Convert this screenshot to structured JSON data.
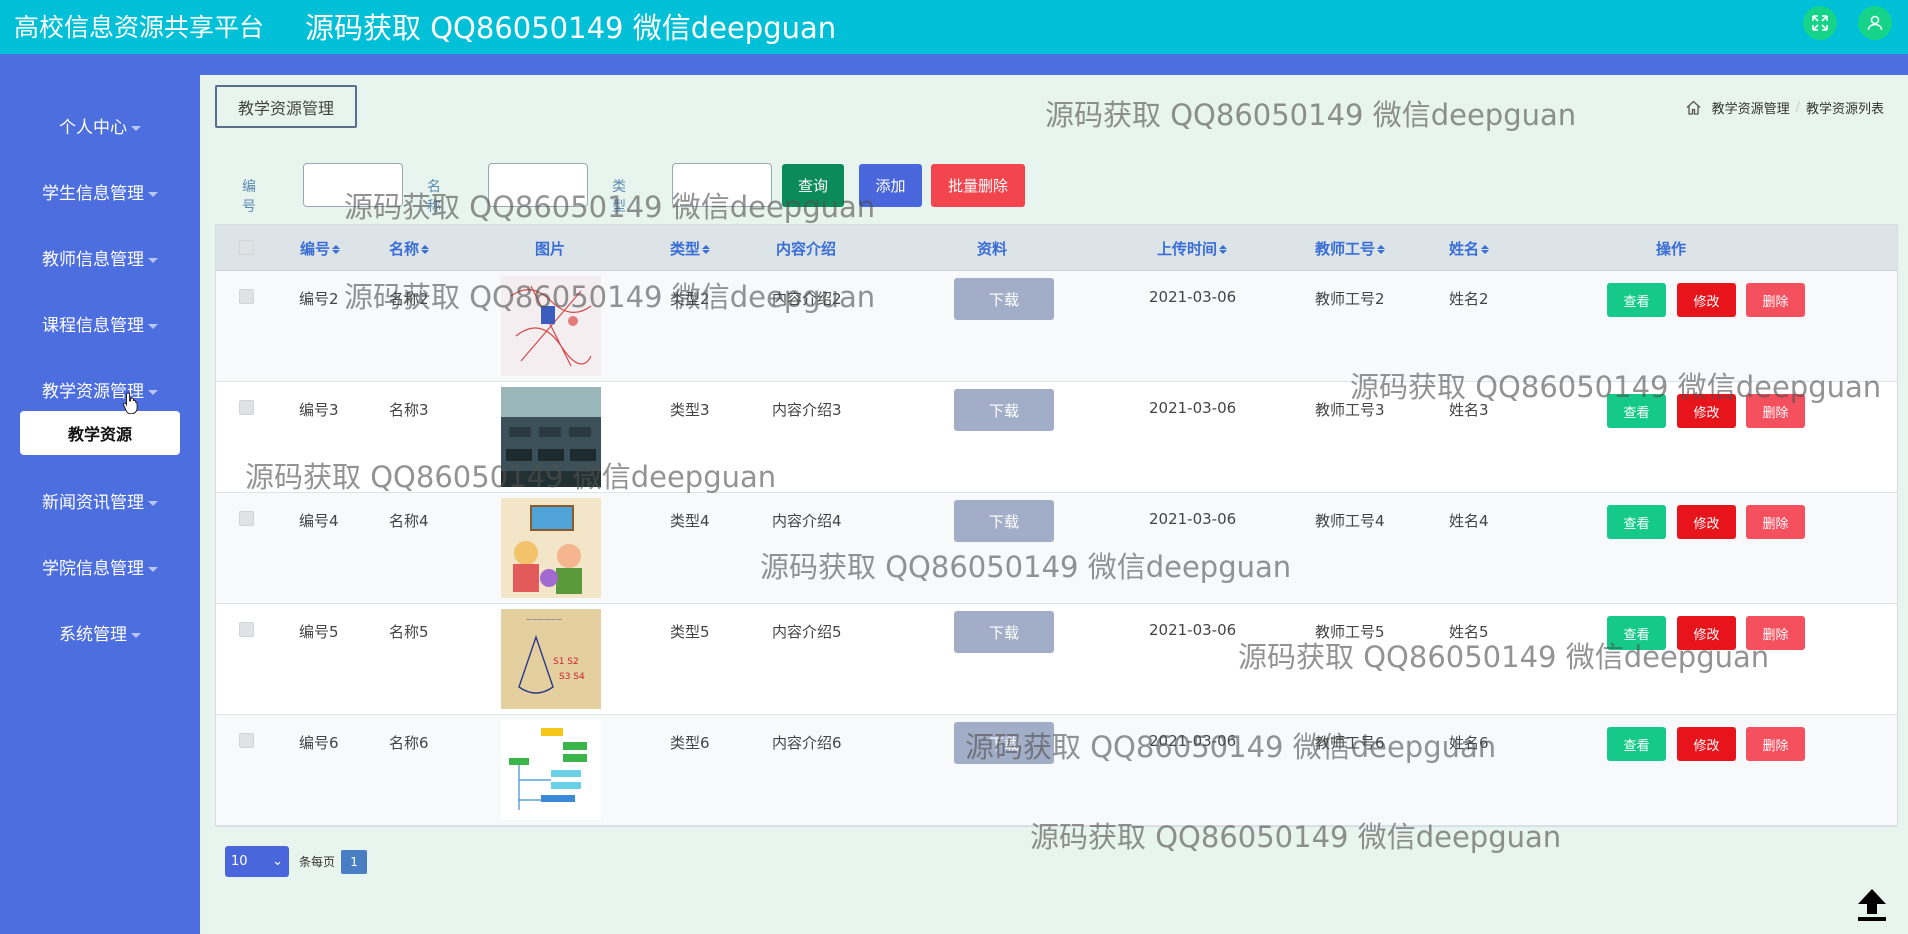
{
  "header": {
    "app_title": "高校信息资源共享平台",
    "banner": "源码获取 QQ86050149 微信deepguan"
  },
  "sidebar": {
    "items": [
      {
        "label": "个人中心"
      },
      {
        "label": "学生信息管理"
      },
      {
        "label": "教师信息管理"
      },
      {
        "label": "课程信息管理"
      },
      {
        "label": "教学资源管理"
      },
      {
        "label": "新闻资讯管理"
      },
      {
        "label": "学院信息管理"
      },
      {
        "label": "系统管理"
      }
    ],
    "active_sub": "教学资源"
  },
  "page": {
    "tag": "教学资源管理",
    "breadcrumb": [
      "教学资源管理",
      "教学资源列表"
    ]
  },
  "search": {
    "label_id": "编号",
    "label_name": "名称",
    "label_type": "类型",
    "btn_query": "查询",
    "btn_add": "添加",
    "btn_batch_delete": "批量删除"
  },
  "table": {
    "headers": [
      "编号",
      "名称",
      "图片",
      "类型",
      "内容介绍",
      "资料",
      "上传时间",
      "教师工号",
      "姓名",
      "操作"
    ],
    "download_label": "下载",
    "actions": {
      "view": "查看",
      "edit": "修改",
      "delete": "删除"
    },
    "rows": [
      {
        "id": "编号2",
        "name": "名称2",
        "type": "类型2",
        "intro": "内容介绍2",
        "time": "2021-03-06",
        "teacher_no": "教师工号2",
        "teacher_name": "姓名2"
      },
      {
        "id": "编号3",
        "name": "名称3",
        "type": "类型3",
        "intro": "内容介绍3",
        "time": "2021-03-06",
        "teacher_no": "教师工号3",
        "teacher_name": "姓名3"
      },
      {
        "id": "编号4",
        "name": "名称4",
        "type": "类型4",
        "intro": "内容介绍4",
        "time": "2021-03-06",
        "teacher_no": "教师工号4",
        "teacher_name": "姓名4"
      },
      {
        "id": "编号5",
        "name": "名称5",
        "type": "类型5",
        "intro": "内容介绍5",
        "time": "2021-03-06",
        "teacher_no": "教师工号5",
        "teacher_name": "姓名5"
      },
      {
        "id": "编号6",
        "name": "名称6",
        "type": "类型6",
        "intro": "内容介绍6",
        "time": "2021-03-06",
        "teacher_no": "教师工号6",
        "teacher_name": "姓名6"
      }
    ]
  },
  "pagination": {
    "page_size": "10",
    "per_page_label": "条每页",
    "current_page": "1"
  },
  "watermark": "源码获取 QQ86050149 微信deepguan"
}
